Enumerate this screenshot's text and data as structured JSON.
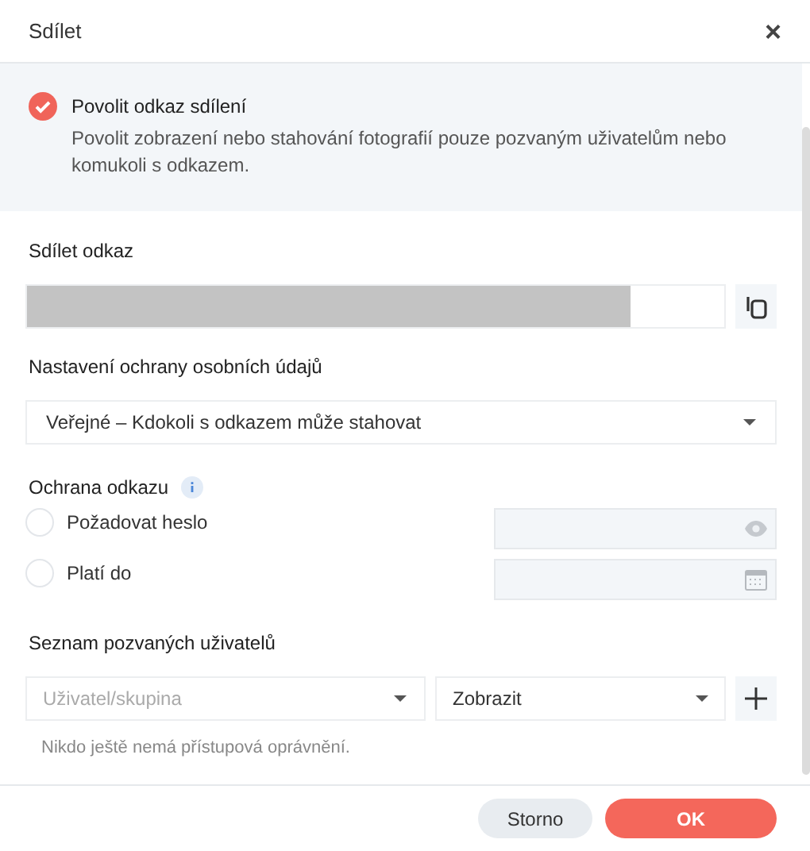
{
  "window": {
    "title": "Sdílet",
    "close": "×"
  },
  "enable_link": {
    "checked": true,
    "label": "Povolit odkaz sdílení",
    "description": "Povolit zobrazení nebo stahování fotografií pouze pozvaným uživatelům nebo komukoli s odkazem."
  },
  "share_link": {
    "label": "Sdílet odkaz"
  },
  "privacy": {
    "label": "Nastavení ochrany osobních údajů",
    "value": "Veřejné – Kdokoli s odkazem může stahovat"
  },
  "protection": {
    "label": "Ochrana odkazu",
    "options": [
      {
        "kind": "password",
        "label": "Požadovat heslo",
        "checked": false
      },
      {
        "kind": "date",
        "label": "Platí do",
        "checked": false
      }
    ]
  },
  "invited": {
    "label": "Seznam pozvaných uživatelů",
    "user_placeholder": "Uživatel/skupina",
    "permission": "Zobrazit",
    "empty": "Nikdo ještě nemá přístupová oprávnění."
  },
  "buttons": [
    {
      "kind": "secondary",
      "label": "Storno"
    },
    {
      "kind": "primary",
      "label": "OK"
    }
  ]
}
